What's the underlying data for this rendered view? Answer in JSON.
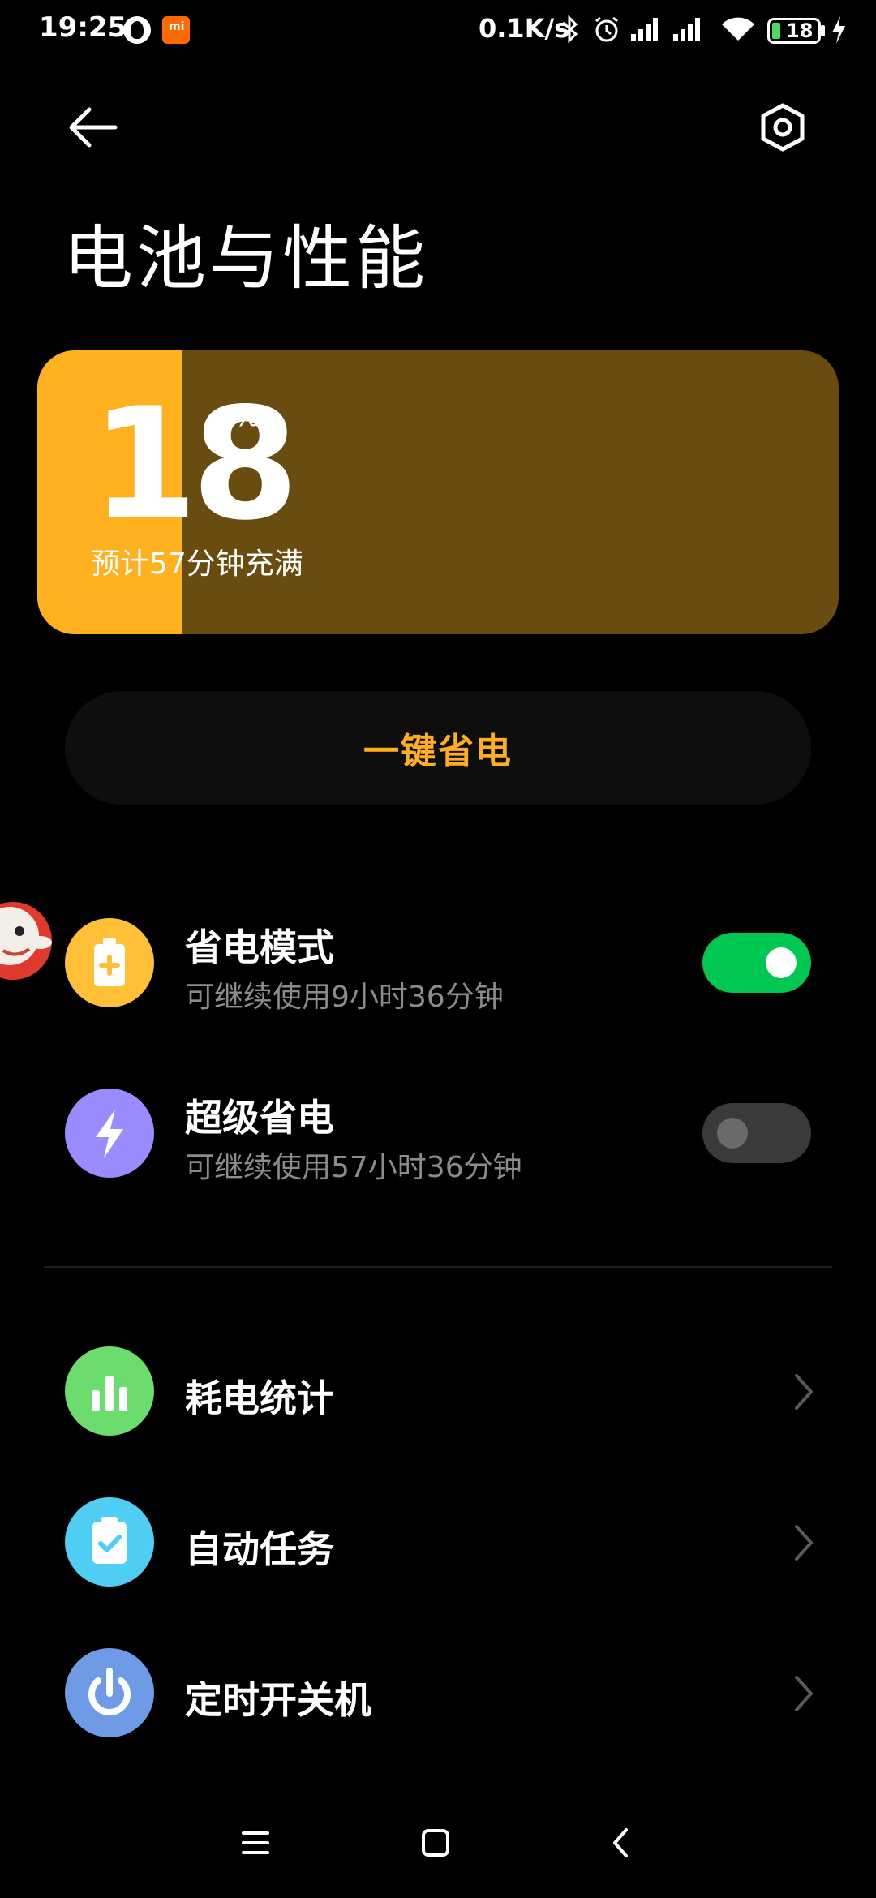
{
  "status_bar": {
    "time": "19:25",
    "network_speed": "0.1K/s",
    "battery_level": "18",
    "icons": [
      "qq-icon",
      "mi-icon",
      "bluetooth-icon",
      "alarm-icon",
      "signal-icon",
      "hd-signal-icon",
      "wifi-icon",
      "battery-icon",
      "charging-icon"
    ]
  },
  "header": {
    "title": "电池与性能"
  },
  "battery": {
    "percent": "18",
    "unit": "%",
    "level_fraction": 0.18,
    "estimate": "预计57分钟充满",
    "fill_color": "#ffb11f",
    "card_color": "#694c0f"
  },
  "one_key_save": {
    "label": "一键省电",
    "color": "#ffae22"
  },
  "modes": [
    {
      "title": "省电模式",
      "subtitle": "可继续使用9小时36分钟",
      "icon": "battery-plus-icon",
      "icon_color": "#ffc038",
      "enabled": true
    },
    {
      "title": "超级省电",
      "subtitle": "可继续使用57小时36分钟",
      "icon": "lightning-icon",
      "icon_color": "#9a8cff",
      "enabled": false
    }
  ],
  "links": [
    {
      "title": "耗电统计",
      "icon": "bar-chart-icon",
      "icon_color": "#6ddc6f"
    },
    {
      "title": "自动任务",
      "icon": "clipboard-check-icon",
      "icon_color": "#4fcdf2"
    },
    {
      "title": "定时开关机",
      "icon": "power-icon",
      "icon_color": "#6e9ae6"
    }
  ],
  "colors": {
    "toggle_on": "#00c853",
    "toggle_off": "#3a3a3a"
  }
}
